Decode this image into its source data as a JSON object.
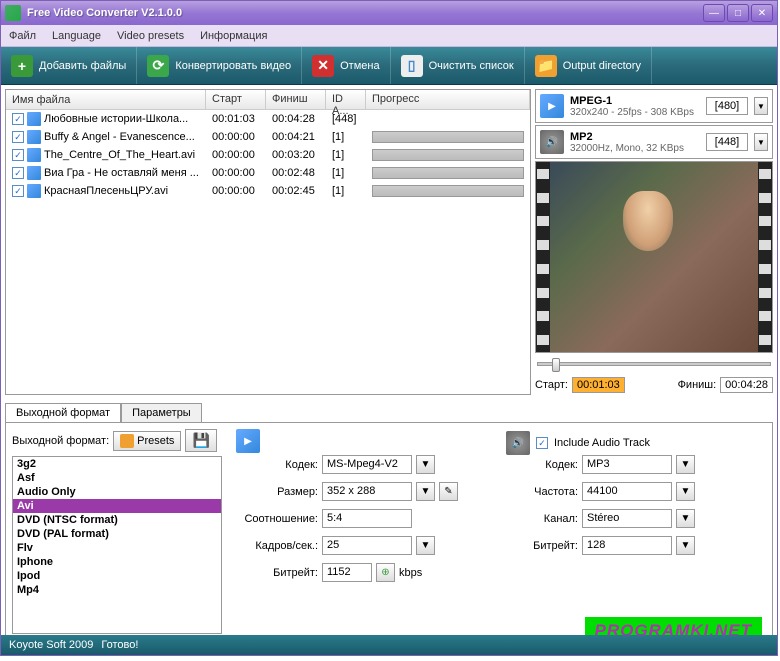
{
  "window": {
    "title": "Free Video Converter V2.1.0.0"
  },
  "menu": [
    "Файл",
    "Language",
    "Video presets",
    "Информация"
  ],
  "toolbar": [
    {
      "label": "Добавить файлы",
      "icon": "plus",
      "bg": "#3a9a3a"
    },
    {
      "label": "Конвертировать видео",
      "icon": "refresh",
      "bg": "#3aa84a"
    },
    {
      "label": "Отмена",
      "icon": "x",
      "bg": "#d03030"
    },
    {
      "label": "Очистить список",
      "icon": "doc",
      "bg": "#eee"
    },
    {
      "label": "Output directory",
      "icon": "folder",
      "bg": "#f0a030"
    }
  ],
  "columns": {
    "name": "Имя файла",
    "start": "Старт",
    "end": "Финиш",
    "id": "ID А...",
    "prog": "Прогресс"
  },
  "files": [
    {
      "name": "Любовные истории-Школа...",
      "start": "00:01:03",
      "end": "00:04:28",
      "id": "[448]",
      "sel": true
    },
    {
      "name": "Buffy & Angel - Evanescence...",
      "start": "00:00:00",
      "end": "00:04:21",
      "id": "[1]"
    },
    {
      "name": "The_Centre_Of_The_Heart.avi",
      "start": "00:00:00",
      "end": "00:03:20",
      "id": "[1]"
    },
    {
      "name": "Виа Гра - Не оставляй меня ...",
      "start": "00:00:00",
      "end": "00:02:48",
      "id": "[1]"
    },
    {
      "name": "КраснаяПлесеньЦРУ.avi",
      "start": "00:00:00",
      "end": "00:02:45",
      "id": "[1]"
    }
  ],
  "vfmt": {
    "name": "MPEG-1",
    "spec": "320x240 - 25fps - 308 KBps",
    "val": "[480]"
  },
  "afmt": {
    "name": "MP2",
    "spec": "32000Hz, Mono, 32 KBps",
    "val": "[448]"
  },
  "time": {
    "startLabel": "Старт:",
    "start": "00:01:03",
    "endLabel": "Финиш:",
    "end": "00:04:28"
  },
  "tabs": {
    "fmt": "Выходной формат",
    "params": "Параметры"
  },
  "outfmt": {
    "label": "Выходной формат:",
    "presets": "Presets"
  },
  "list": [
    "3g2",
    "Asf",
    "Audio Only",
    "Avi",
    "DVD (NTSC format)",
    "DVD (PAL format)",
    "Flv",
    "Iphone",
    "Ipod",
    "Mp4"
  ],
  "listsel": "Avi",
  "vf": {
    "codec": {
      "l": "Кодек:",
      "v": "MS-Mpeg4-V2"
    },
    "size": {
      "l": "Размер:",
      "v": "352 x 288"
    },
    "ratio": {
      "l": "Соотношение:",
      "v": "5:4"
    },
    "fps": {
      "l": "Кадров/сек.:",
      "v": "25"
    },
    "br": {
      "l": "Битрейт:",
      "v": "1152",
      "u": "kbps"
    }
  },
  "af": {
    "include": "Include Audio Track",
    "codec": {
      "l": "Кодек:",
      "v": "MP3"
    },
    "freq": {
      "l": "Частота:",
      "v": "44100"
    },
    "chan": {
      "l": "Канал:",
      "v": "Stéreo"
    },
    "br": {
      "l": "Битрейт:",
      "v": "128"
    }
  },
  "status": {
    "copyright": "Koyote Soft 2009",
    "msg": "Готово!"
  },
  "watermark": "PROGRAMKI.NET"
}
